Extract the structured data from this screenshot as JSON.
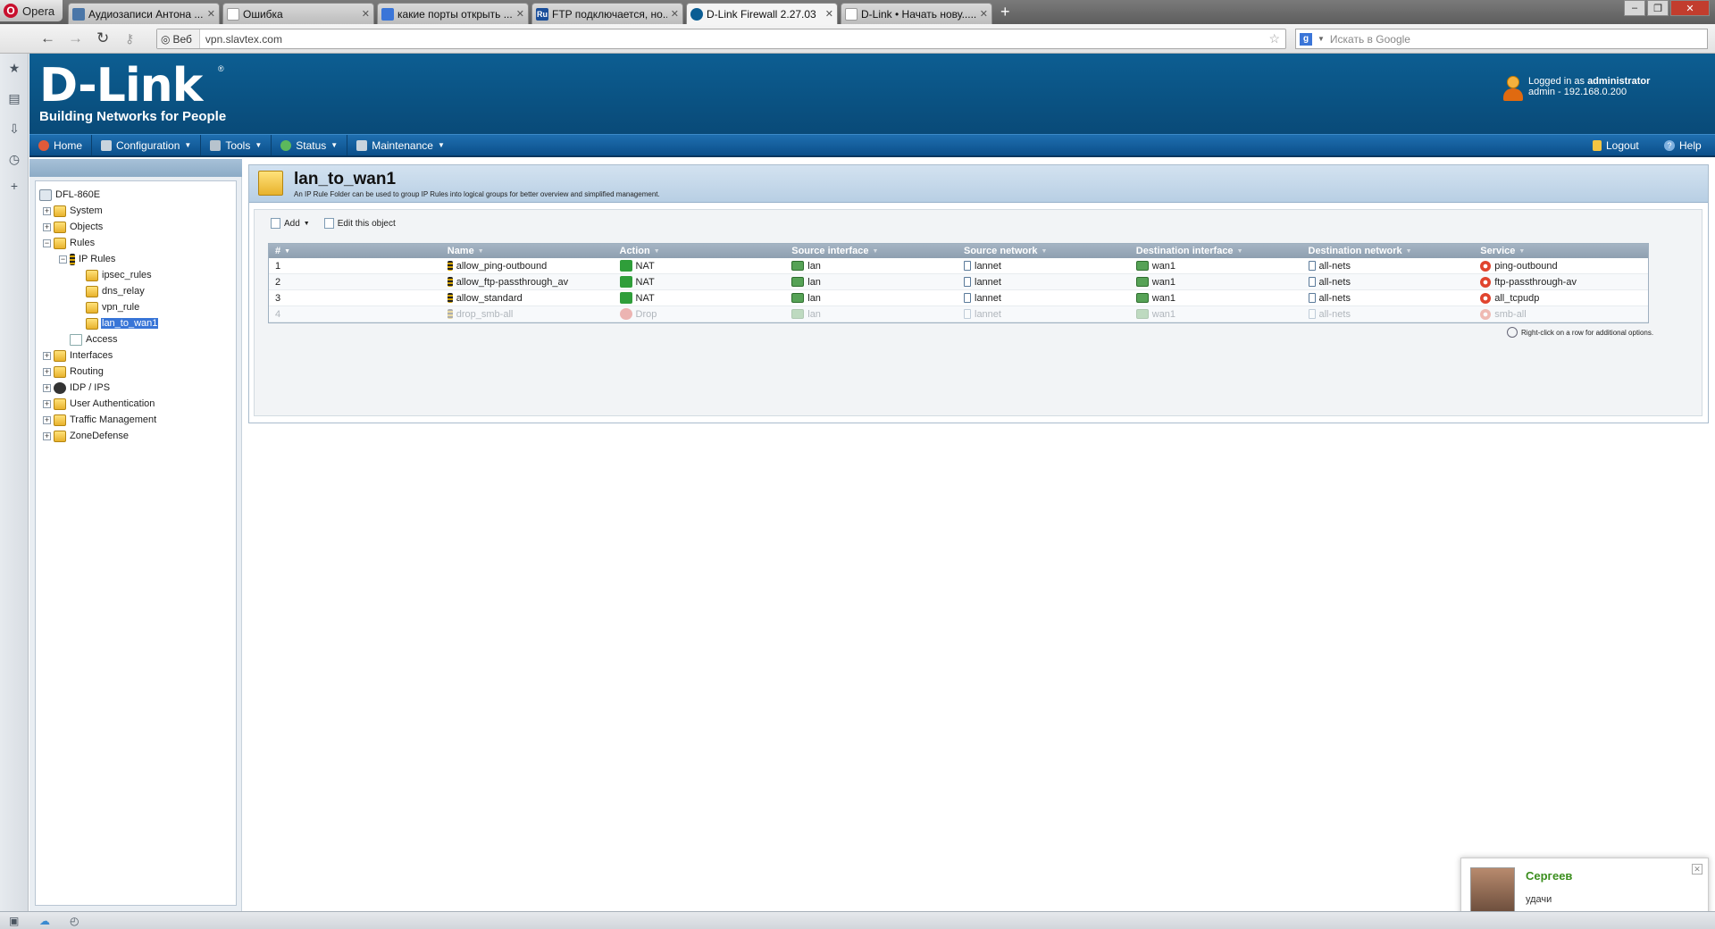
{
  "browser": {
    "opera_label": "Opera",
    "tabs": [
      {
        "title": "Аудиозаписи Антона ...",
        "color": "#4a76a8"
      },
      {
        "title": "Ошибка",
        "color": "#ffffff"
      },
      {
        "title": "какие порты открыть ...",
        "color": "#3a75d8"
      },
      {
        "title": "FTP подключается, но...",
        "color": "#1a4e9a",
        "badge": "Ru"
      },
      {
        "title": "D-Link Firewall 2.27.03",
        "color": "#0b5d93"
      },
      {
        "title": "D-Link • Начать нову......",
        "color": "#ffffff"
      }
    ],
    "address_proto": "Веб",
    "address": "vpn.slavtex.com",
    "search_placeholder": "Искать в Google"
  },
  "header": {
    "logo": "D-Link",
    "tagline": "Building Networks for People",
    "logged_in_prefix": "Logged in as ",
    "user_role": "administrator",
    "user_line2": "admin - 192.168.0.200"
  },
  "menu": {
    "items": [
      "Home",
      "Configuration",
      "Tools",
      "Status",
      "Maintenance"
    ],
    "logout": "Logout",
    "help": "Help"
  },
  "tree": {
    "root": "DFL-860E",
    "system": "System",
    "objects": "Objects",
    "rules": "Rules",
    "ip_rules": "IP Rules",
    "ipsec_rules": "ipsec_rules",
    "dns_relay": "dns_relay",
    "vpn_rule": "vpn_rule",
    "lan_to_wan1": "lan_to_wan1",
    "access": "Access",
    "interfaces": "Interfaces",
    "routing": "Routing",
    "idp": "IDP / IPS",
    "user_auth": "User Authentication",
    "traffic": "Traffic Management",
    "zonedefense": "ZoneDefense"
  },
  "content": {
    "title": "lan_to_wan1",
    "description": "An IP Rule Folder can be used to group IP Rules into logical groups for better overview and simplified management.",
    "add": "Add",
    "edit": "Edit this object",
    "hint": "Right-click on a row for additional options.",
    "columns": [
      "#",
      "Name",
      "Action",
      "Source interface",
      "Source network",
      "Destination interface",
      "Destination network",
      "Service"
    ],
    "rows": [
      [
        "1",
        "allow_ping-outbound",
        "NAT",
        "lan",
        "lannet",
        "wan1",
        "all-nets",
        "ping-outbound"
      ],
      [
        "2",
        "allow_ftp-passthrough_av",
        "NAT",
        "lan",
        "lannet",
        "wan1",
        "all-nets",
        "ftp-passthrough-av"
      ],
      [
        "3",
        "allow_standard",
        "NAT",
        "lan",
        "lannet",
        "wan1",
        "all-nets",
        "all_tcpudp"
      ],
      [
        "4",
        "drop_smb-all",
        "Drop",
        "lan",
        "lannet",
        "wan1",
        "all-nets",
        "smb-all"
      ]
    ]
  },
  "notification": {
    "name": "Сергеев",
    "message": "удачи"
  }
}
